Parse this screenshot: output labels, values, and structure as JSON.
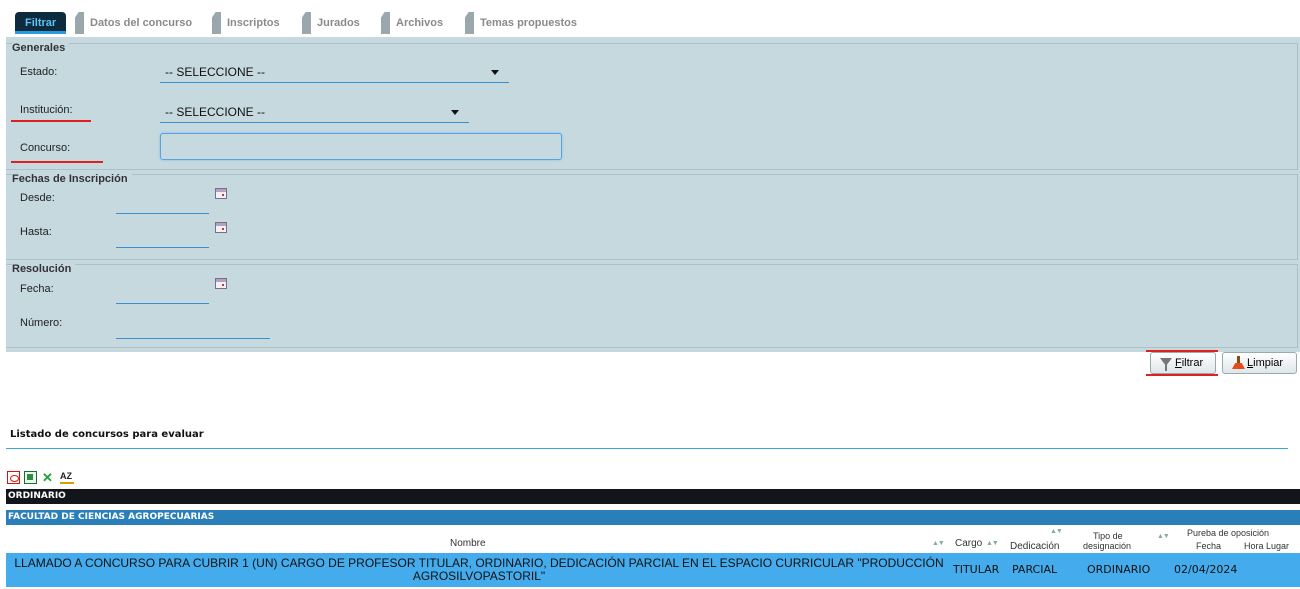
{
  "tabs": [
    {
      "label": "Filtrar",
      "active": true
    },
    {
      "label": "Datos del concurso"
    },
    {
      "label": "Inscriptos"
    },
    {
      "label": "Jurados"
    },
    {
      "label": "Archivos"
    },
    {
      "label": "Temas propuestos"
    }
  ],
  "generales": {
    "legend": "Generales",
    "estado_label": "Estado:",
    "estado_value": "-- SELECCIONE --",
    "institucion_label": "Institución:",
    "institucion_value": "-- SELECCIONE --",
    "concurso_label": "Concurso:",
    "concurso_value": ""
  },
  "fechas": {
    "legend": "Fechas de Inscripción",
    "desde_label": "Desde:",
    "hasta_label": "Hasta:"
  },
  "resolucion": {
    "legend": "Resolución",
    "fecha_label": "Fecha:",
    "numero_label": "Número:"
  },
  "buttons": {
    "filtrar_accel": "F",
    "filtrar_rest": "iltrar",
    "limpiar_accel": "L",
    "limpiar_rest": "impiar"
  },
  "listado": {
    "title": "Listado de concursos para evaluar",
    "group1": "ORDINARIO",
    "group2": "FACULTAD DE CIENCIAS AGROPECUARIAS",
    "headers": {
      "nombre": "Nombre",
      "cargo": "Cargo",
      "dedicacion": "Dedicación",
      "tipo_line1": "Tipo de",
      "tipo_line2": "designación",
      "prueba": "Pureba de oposición",
      "fecha": "Fecha",
      "hora_lugar": "Hora Lugar"
    },
    "rows": [
      {
        "nombre_line1": "LLAMADO A CONCURSO PARA CUBRIR 1 (UN) CARGO DE PROFESOR TITULAR, ORDINARIO, DEDICACIÓN PARCIAL EN EL ESPACIO CURRICULAR \"PRODUCCIÓN",
        "nombre_line2": "AGROSILVOPASTORIL\"",
        "cargo": "TITULAR",
        "dedicacion": "PARCIAL",
        "tipo": "ORDINARIO",
        "fecha": "02/04/2024"
      }
    ]
  },
  "colors": {
    "panel_bg": "#c5d9df",
    "active_tab": "#0e2a3d",
    "row_bg": "#44abec",
    "group1_bg": "#12161b",
    "group2_bg": "#2a7fb8",
    "highlight": "#e02020"
  },
  "icons": [
    "calendar-icon",
    "funnel-icon",
    "broom-icon",
    "pdf-icon",
    "excel-icon",
    "clear-excel-icon",
    "sort-az-icon"
  ]
}
